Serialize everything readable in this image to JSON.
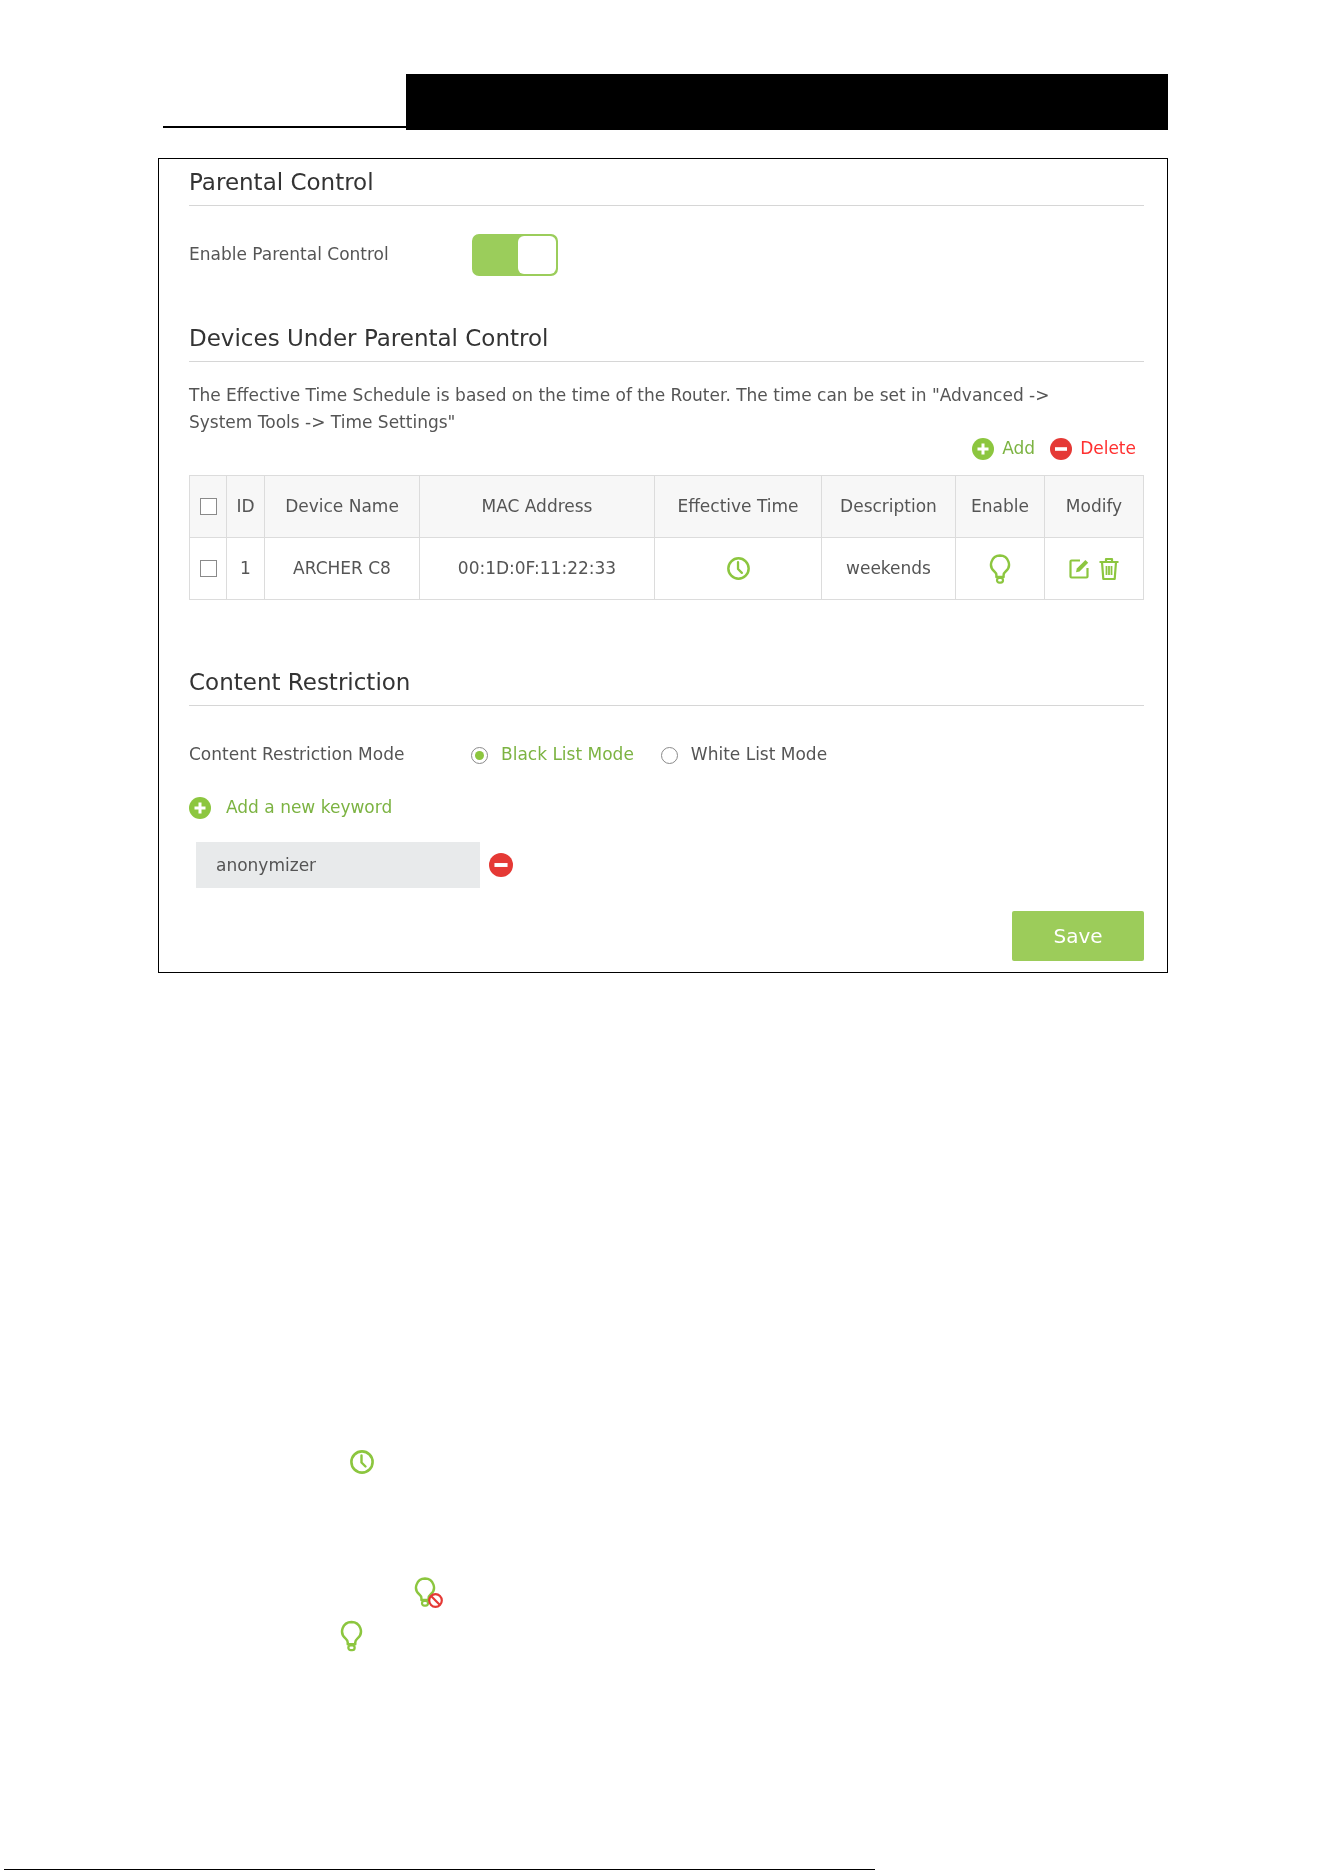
{
  "parental_control": {
    "title": "Parental Control",
    "enable": {
      "label": "Enable Parental Control",
      "on": true
    }
  },
  "devices": {
    "title": "Devices Under Parental Control",
    "note": "The Effective Time Schedule is based on the time of the Router. The time can be set in \"Advanced -> System Tools -> Time Settings\"",
    "actions": [
      {
        "kind": "add",
        "label": "Add"
      },
      {
        "kind": "delete",
        "label": "Delete"
      }
    ],
    "table": {
      "select_all": {
        "checked": false
      },
      "columns": [
        "ID",
        "Device Name",
        "MAC Address",
        "Effective Time",
        "Description",
        "Enable",
        "Modify"
      ],
      "rows": [
        {
          "checked": false,
          "id": "1",
          "device_name": "ARCHER C8",
          "mac_address": "00:1D:0F:11:22:33",
          "description": "weekends",
          "enabled": true
        }
      ]
    }
  },
  "content_restriction": {
    "title": "Content Restriction",
    "mode_label": "Content Restriction Mode",
    "modes": [
      {
        "label": "Black List Mode",
        "selected": true
      },
      {
        "label": "White List Mode",
        "selected": false
      }
    ],
    "add_keyword": "Add a new keyword",
    "keywords": [
      {
        "value": "anonymizer"
      }
    ],
    "save": "Save"
  }
}
